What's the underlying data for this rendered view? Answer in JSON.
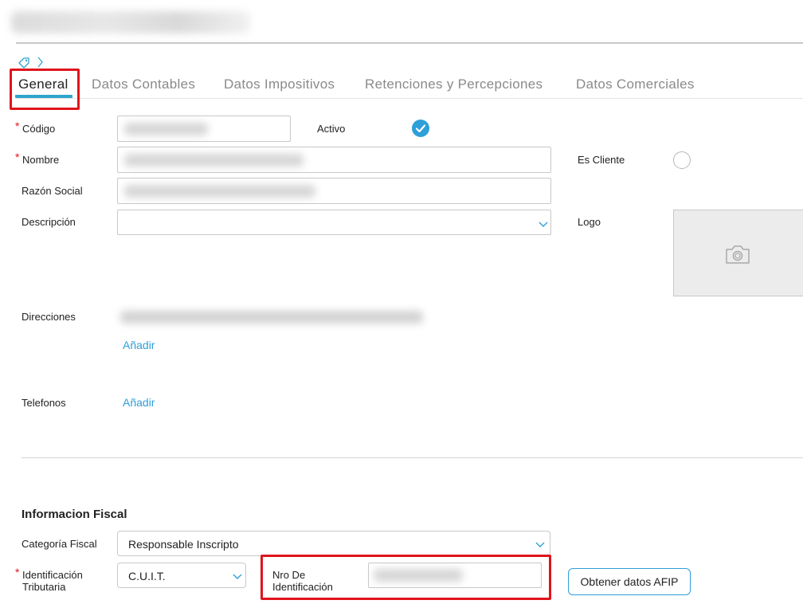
{
  "tabs": [
    {
      "label": "General",
      "active": true
    },
    {
      "label": "Datos Contables"
    },
    {
      "label": "Datos Impositivos"
    },
    {
      "label": "Retenciones y Percepciones"
    },
    {
      "label": "Datos Comerciales"
    }
  ],
  "form": {
    "codigo_label": "Código",
    "nombre_label": "Nombre",
    "razon_social_label": "Razón Social",
    "descripcion_label": "Descripción",
    "direcciones_label": "Direcciones",
    "telefonos_label": "Telefonos",
    "activo_label": "Activo",
    "es_cliente_label": "Es Cliente",
    "logo_label": "Logo",
    "anadir_link": "Añadir",
    "required_mark": "*"
  },
  "fiscal": {
    "section_title": "Informacion Fiscal",
    "categoria_label": "Categoría Fiscal",
    "categoria_value": "Responsable Inscripto",
    "identificacion_label_1": "Identificación",
    "identificacion_label_2": "Tributaria",
    "identificacion_value": "C.U.I.T.",
    "nro_label_1": "Nro De",
    "nro_label_2": "Identificación",
    "obtener_button": "Obtener datos AFIP"
  },
  "colors": {
    "accent": "#2e9fd9",
    "highlight": "#e0141c"
  },
  "icons": {
    "breadcrumb": "tag-icon",
    "breadcrumb_sep": "chevron-right-icon",
    "activo": "check-circle-icon",
    "logo": "camera-icon"
  }
}
